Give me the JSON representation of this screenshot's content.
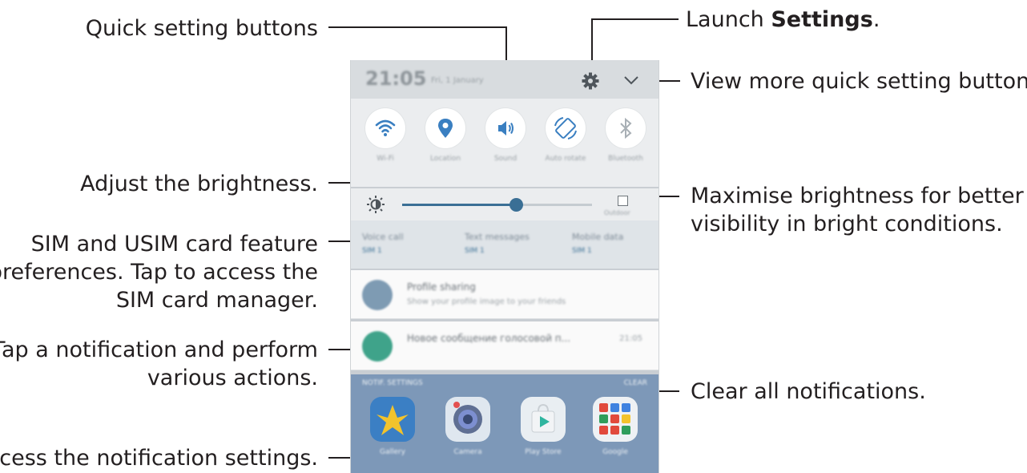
{
  "callouts": {
    "quick_setting_buttons": "Quick setting buttons",
    "launch_settings_prefix": "Launch ",
    "launch_settings_bold": "Settings",
    "launch_settings_suffix": ".",
    "view_more": "View more quick setting buttons.",
    "adjust_brightness": "Adjust the brightness.",
    "maximise_line1": "Maximise brightness for better",
    "maximise_line2": "visibility in bright conditions.",
    "sim_line1": "SIM and USIM card feature",
    "sim_line2": "preferences. Tap to access the",
    "sim_line3": "SIM card manager.",
    "tap_notif_line1": "Tap a notification and perform",
    "tap_notif_line2": "various actions.",
    "clear_all": "Clear all notifications.",
    "access_settings": "Access the notification settings."
  },
  "phone": {
    "status": {
      "time": "21:05",
      "date": "Fri, 1 January"
    },
    "quick_settings": [
      {
        "label": "Wi-Fi",
        "icon": "wifi-icon"
      },
      {
        "label": "Location",
        "icon": "location-icon"
      },
      {
        "label": "Sound",
        "icon": "sound-icon"
      },
      {
        "label": "Auto rotate",
        "icon": "auto-rotate-icon"
      },
      {
        "label": "Bluetooth",
        "icon": "bluetooth-icon"
      }
    ],
    "brightness": {
      "level": 0.6,
      "outdoor_label": "Outdoor",
      "outdoor_checked": false
    },
    "sim": [
      {
        "title": "Voice call",
        "sub": "SIM 1"
      },
      {
        "title": "Text messages",
        "sub": "SIM 1"
      },
      {
        "title": "Mobile data",
        "sub": "SIM 1"
      }
    ],
    "notifications": [
      {
        "title": "Profile sharing",
        "text": "Show your profile image to your friends",
        "time": "",
        "icon_color": "#7e9bb3"
      },
      {
        "title": "Новое сообщение голосовой п...",
        "text": "",
        "time": "21:05",
        "icon_color": "#3fa38a"
      }
    ],
    "footer": {
      "notif_settings": "NOTIF. SETTINGS",
      "clear": "CLEAR"
    },
    "apps": [
      {
        "label": "Gallery",
        "color": "#3b7fc4"
      },
      {
        "label": "Camera",
        "color": "#dfe7ef"
      },
      {
        "label": "Play Store",
        "color": "#e9eef2"
      },
      {
        "label": "Google",
        "color": "#eef1f4"
      }
    ],
    "colors": {
      "accent": "#3a6f95",
      "panel": "#ebedef"
    }
  }
}
